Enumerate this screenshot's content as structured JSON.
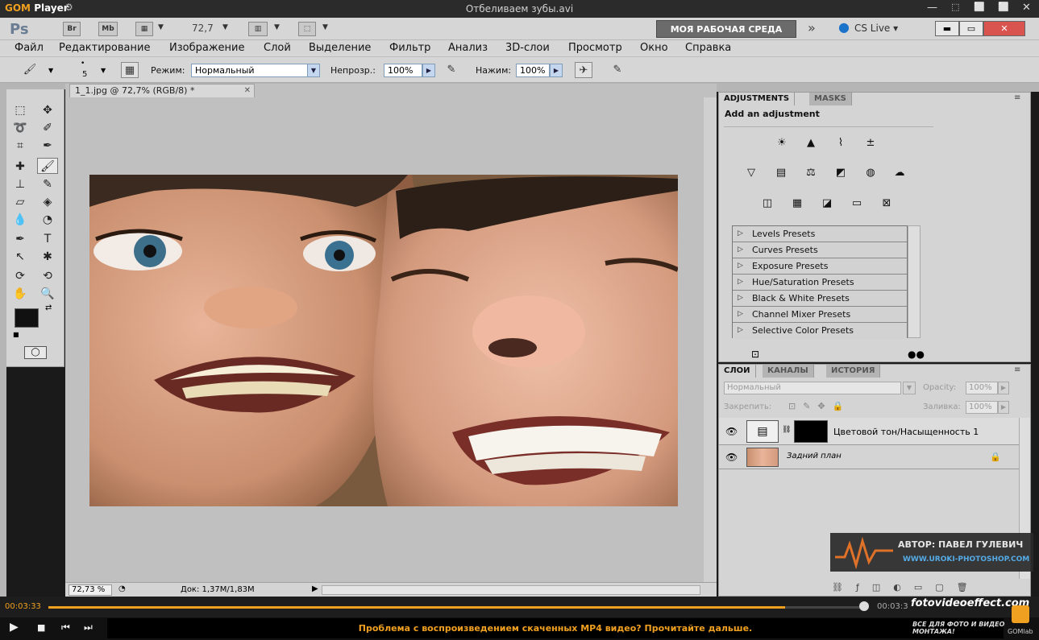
{
  "gom": {
    "logo_a": "GOM",
    "logo_b": "Player",
    "video_title": "Отбеливаем зубы.avi",
    "time_current": "00:03:33",
    "time_total": "00:03:3",
    "notice": "Проблема с воспроизведением скаченных MP4 видео? Прочитайте дальше.",
    "gomlab": "GOMlab",
    "progress": 0.9
  },
  "ps": {
    "logo": "Ps",
    "bridge": "Br",
    "minibridge": "Mb",
    "zoom": "72,7",
    "workspace": "МОЯ РАБОЧАЯ СРЕДА",
    "cs_live": "CS Live",
    "menu": [
      "Файл",
      "Редактирование",
      "Изображение",
      "Слой",
      "Выделение",
      "Фильтр",
      "Анализ",
      "3D-слои",
      "Просмотр",
      "Окно",
      "Справка"
    ],
    "options": {
      "brush_size": "5",
      "mode_label": "Режим:",
      "mode_value": "Нормальный",
      "opacity_label": "Непрозр.:",
      "opacity_value": "100%",
      "flow_label": "Нажим:",
      "flow_value": "100%"
    },
    "doc_tab": "1_1.jpg @ 72,7% (RGB/8) *",
    "status": {
      "zoom": "72,73 %",
      "doc": "Док: 1,37M/1,83M"
    }
  },
  "adjustments": {
    "tab_adjust": "ADJUSTMENTS",
    "tab_masks": "MASKS",
    "title": "Add an adjustment",
    "presets": [
      "Levels Presets",
      "Curves Presets",
      "Exposure Presets",
      "Hue/Saturation Presets",
      "Black & White Presets",
      "Channel Mixer Presets",
      "Selective Color Presets"
    ]
  },
  "layers": {
    "tabs": [
      "СЛОИ",
      "КАНАЛЫ",
      "ИСТОРИЯ"
    ],
    "blend": "Нормальный",
    "opacity_label": "Opacity:",
    "opacity_value": "100%",
    "lock_label": "Закрепить:",
    "fill_label": "Заливка:",
    "fill_value": "100%",
    "items": [
      {
        "name": "Цветовой тон/Насыщенность 1"
      },
      {
        "name": "Задний план"
      }
    ]
  },
  "watermark": {
    "author": "АВТОР: ПАВЕЛ ГУЛЕВИЧ",
    "site": "WWW.UROKI-PHOTOSHOP.COM",
    "brand": "fotovideoeffect.com",
    "tagline": "ВСЕ ДЛЯ ФОТО И ВИДЕО МОНТАЖА!"
  }
}
